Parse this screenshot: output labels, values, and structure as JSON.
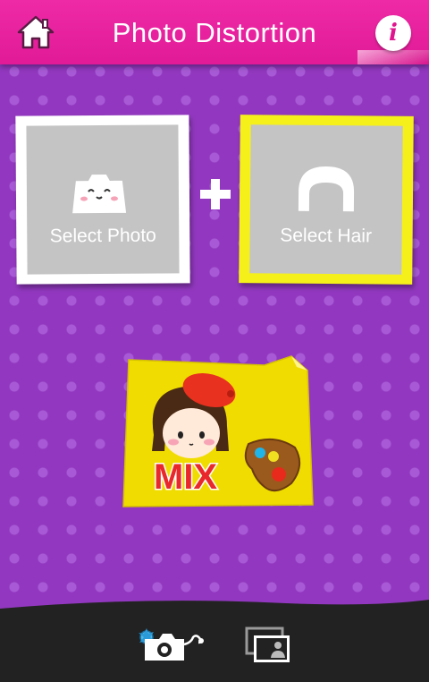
{
  "header": {
    "title": "Photo Distortion",
    "home_icon": "home-icon",
    "info_icon": "info-icon",
    "info_glyph": "i",
    "color": "#e91e9c"
  },
  "selectors": {
    "photo": {
      "label": "Select Photo",
      "icon": "bag-face-icon"
    },
    "hair": {
      "label": "Select Hair",
      "icon": "hair-icon"
    },
    "plus_icon": "plus-icon"
  },
  "mix": {
    "label": "MIX",
    "icon": "girl-beret-palette-icon"
  },
  "bottom_bar": {
    "camera_icon": "camera-icon",
    "gallery_icon": "gallery-icon"
  },
  "colors": {
    "background": "#9238c0",
    "header": "#e91e9c",
    "hair_frame": "#f5f01a",
    "mix_card": "#f0dc00",
    "bottom_bar": "#222222"
  }
}
